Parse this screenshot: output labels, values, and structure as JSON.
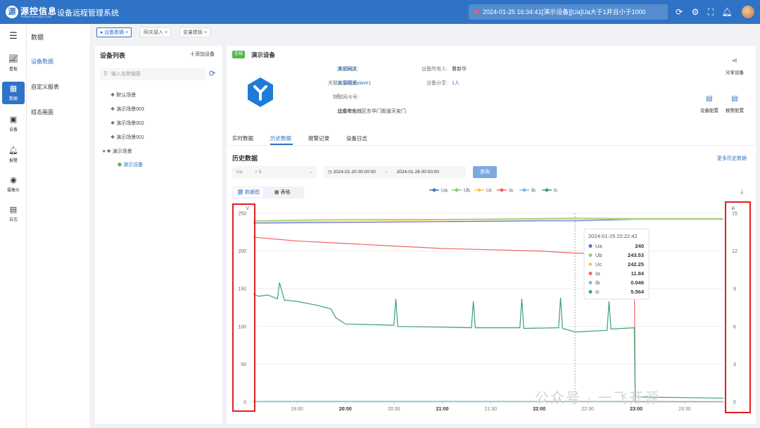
{
  "app": {
    "logo_text": "源控信息",
    "logo_sub": "YUANKONGXINXI.COM",
    "title": "设备远程管理系统"
  },
  "alert": {
    "text": "2024-01-25 16:34:41[演示设备][Ua]Ua大于1并且小于1000"
  },
  "topicons": [
    "refresh-icon",
    "settings-icon",
    "fullscreen-icon",
    "bell-icon"
  ],
  "nav": [
    {
      "label": "看板",
      "icon": "dashboard-icon"
    },
    {
      "label": "数据",
      "icon": "data-icon"
    },
    {
      "label": "设备",
      "icon": "device-icon"
    },
    {
      "label": "报警",
      "icon": "alarm-icon"
    },
    {
      "label": "摄像头",
      "icon": "camera-icon"
    },
    {
      "label": "日志",
      "icon": "log-icon"
    }
  ],
  "subnav": {
    "title": "数据",
    "items": [
      "设备数据",
      "自定义报表",
      "组态画面"
    ]
  },
  "pagetabs": [
    "设备数据",
    "网关接入",
    "变量模板"
  ],
  "devlist": {
    "title": "设备列表",
    "add": "十添加设备",
    "search_placeholder": "输入名称搜索",
    "tree": [
      "默认场景",
      "演示场景003",
      "演示场景002",
      "演示场景001",
      "演示场景",
      "演示设备"
    ]
  },
  "device": {
    "status": "在线",
    "name": "演示设备",
    "fields": [
      {
        "label": "关联网关:",
        "value": "演示网关"
      },
      {
        "label": "关联变量模板:",
        "value": "演示网关slave1"
      },
      {
        "label": "物联网卡号:",
        "value": "/"
      },
      {
        "label": "设备地址:",
        "value": "北京市东城区东华门街道天安门"
      },
      {
        "label": "设备所有人:",
        "value": "曹新华"
      },
      {
        "label": "设备分享:",
        "value": "1人"
      }
    ],
    "actions": [
      "分享设备",
      "设备配置",
      "报警配置"
    ]
  },
  "datatabs": [
    "实时数据",
    "历史数据",
    "报警记录",
    "设备日志"
  ],
  "history": {
    "title": "历史数据",
    "more": "更多历史数据",
    "var_select": "Ua",
    "var_more": "+ 5",
    "start": "2024-01-20 00:00:00",
    "sep": "-",
    "end": "2024-01-26 00:00:00",
    "query": "查询",
    "view_chart": "数据图",
    "view_table": "表格"
  },
  "chart_data": {
    "type": "line",
    "left_axis_unit": "V",
    "right_axis_unit": "A",
    "left_ticks": [
      0,
      50,
      100,
      150,
      200,
      250
    ],
    "right_ticks": [
      0,
      3,
      6,
      9,
      12,
      15
    ],
    "ylim_left": [
      0,
      250
    ],
    "ylim_right": [
      0,
      15
    ],
    "x_ticks": [
      "19:30",
      "20:00",
      "20:30",
      "21:00",
      "21:30",
      "22:00",
      "22:30",
      "23:00",
      "23:30"
    ],
    "x_bold": [
      "20:00",
      "21:00",
      "22:00",
      "23:00"
    ],
    "x_hours": [
      19.5,
      20,
      20.5,
      21,
      21.5,
      22,
      22.5,
      23,
      23.5
    ],
    "xlim_hours": [
      19.05,
      23.9
    ],
    "series": [
      {
        "name": "Ua",
        "color": "#5470c6",
        "axis": "left",
        "points": [
          [
            19.05,
            237
          ],
          [
            20.0,
            238
          ],
          [
            21.0,
            239
          ],
          [
            22.0,
            240
          ],
          [
            22.37,
            240
          ],
          [
            23.0,
            242
          ],
          [
            23.9,
            242
          ]
        ]
      },
      {
        "name": "Ub",
        "color": "#91cc75",
        "axis": "left",
        "points": [
          [
            19.05,
            240
          ],
          [
            20.0,
            242
          ],
          [
            21.0,
            242
          ],
          [
            22.0,
            243
          ],
          [
            22.37,
            243.53
          ],
          [
            23.0,
            243
          ],
          [
            23.9,
            243
          ]
        ]
      },
      {
        "name": "Uc",
        "color": "#fac858",
        "axis": "left",
        "points": [
          [
            19.05,
            239
          ],
          [
            20.0,
            240
          ],
          [
            21.0,
            241
          ],
          [
            22.0,
            242
          ],
          [
            22.37,
            242.25
          ],
          [
            23.0,
            242
          ],
          [
            23.9,
            242
          ]
        ]
      },
      {
        "name": "Ia",
        "color": "#ee6666",
        "axis": "right",
        "points": [
          [
            19.05,
            13.1
          ],
          [
            19.5,
            12.8
          ],
          [
            20.0,
            12.6
          ],
          [
            20.5,
            12.4
          ],
          [
            21.0,
            12.2
          ],
          [
            21.5,
            12.1
          ],
          [
            22.0,
            12.0
          ],
          [
            22.37,
            11.84
          ],
          [
            22.98,
            11.7
          ],
          [
            22.99,
            0.02
          ],
          [
            23.9,
            0.02
          ]
        ]
      },
      {
        "name": "Ib",
        "color": "#73c0de",
        "axis": "right",
        "points": [
          [
            19.05,
            0.05
          ],
          [
            22.37,
            0.046
          ],
          [
            23.9,
            0.04
          ]
        ]
      },
      {
        "name": "Ic",
        "color": "#3ba272",
        "axis": "right",
        "points": [
          [
            19.05,
            8.6
          ],
          [
            19.1,
            8.4
          ],
          [
            19.2,
            8.5
          ],
          [
            19.3,
            8.2
          ],
          [
            19.32,
            9.5
          ],
          [
            19.37,
            8.1
          ],
          [
            19.5,
            8.0
          ],
          [
            19.7,
            7.7
          ],
          [
            19.85,
            7.4
          ],
          [
            19.9,
            6.7
          ],
          [
            20.0,
            6.2
          ],
          [
            20.5,
            6.1
          ],
          [
            20.52,
            8.2
          ],
          [
            20.54,
            6.0
          ],
          [
            21.0,
            5.95
          ],
          [
            21.3,
            5.9
          ],
          [
            21.32,
            8.0
          ],
          [
            21.34,
            5.9
          ],
          [
            21.8,
            5.9
          ],
          [
            21.82,
            8.2
          ],
          [
            21.84,
            5.85
          ],
          [
            22.2,
            5.9
          ],
          [
            22.22,
            8.3
          ],
          [
            22.24,
            5.85
          ],
          [
            22.37,
            5.564
          ],
          [
            22.7,
            5.7
          ],
          [
            22.72,
            8.0
          ],
          [
            22.74,
            5.8
          ],
          [
            22.98,
            5.9
          ],
          [
            22.99,
            0.4
          ],
          [
            23.9,
            0.3
          ]
        ]
      }
    ],
    "tooltip": {
      "time": "2024-01-25 22:22:42",
      "rows": [
        {
          "name": "Ua",
          "value": "240",
          "color": "#5470c6"
        },
        {
          "name": "Ub",
          "value": "243.53",
          "color": "#91cc75"
        },
        {
          "name": "Uc",
          "value": "242.25",
          "color": "#fac858"
        },
        {
          "name": "Ia",
          "value": "11.84",
          "color": "#ee6666"
        },
        {
          "name": "Ib",
          "value": "0.046",
          "color": "#73c0de"
        },
        {
          "name": "Ic",
          "value": "5.564",
          "color": "#3ba272"
        }
      ]
    }
  },
  "watermark": "公众号 · 一飞开源"
}
